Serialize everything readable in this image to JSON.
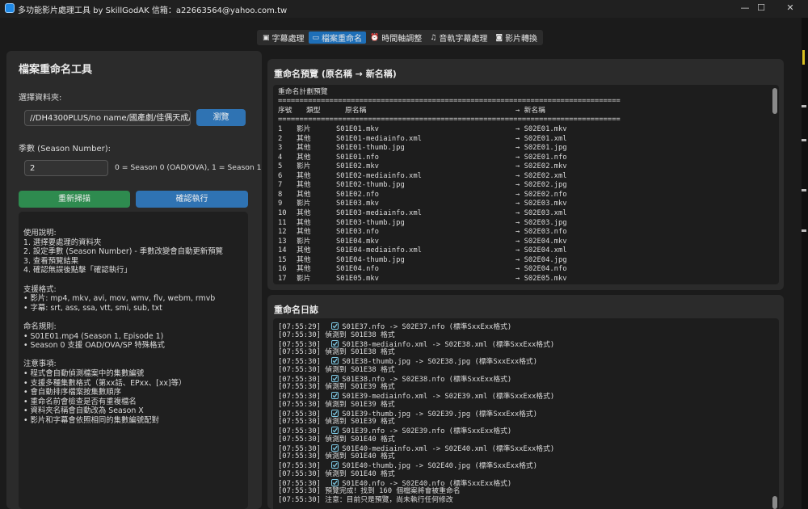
{
  "window": {
    "title": "多功能影片處理工具 by SkillGodAK 信箱：a22663564@yahoo.com.tw",
    "minimize_glyph": "—",
    "maximize_glyph": "☐",
    "close_glyph": "✕"
  },
  "tabs": [
    {
      "icon": "subtitle-icon",
      "glyph": "▣",
      "label": "字幕處理"
    },
    {
      "icon": "rename-icon",
      "glyph": "▭",
      "label": "檔案重命名"
    },
    {
      "icon": "timer-icon",
      "glyph": "⏰",
      "label": "時間軸調整"
    },
    {
      "icon": "music-icon",
      "glyph": "♫",
      "label": "音軌字幕處理"
    },
    {
      "icon": "convert-icon",
      "glyph": "◙",
      "label": "影片轉換"
    }
  ],
  "left": {
    "title": "檔案重命名工具",
    "folder_label": "選擇資料夾:",
    "folder_value": "//DH4300PLUS/no name/國產劇/佳偶天成/Se",
    "browse_label": "瀏覽",
    "season_label": "季數 (Season Number):",
    "season_value": "2",
    "season_hint": "0 = Season 0 (OAD/OVA), 1 = Season 1",
    "rescan_label": "重新掃描",
    "confirm_label": "確認執行",
    "instructions": [
      "使用說明:",
      "1. 選擇要處理的資料夾",
      "2. 設定季數 (Season Number) - 季數改變會自動更新預覽",
      "3. 查看預覽結果",
      "4. 確認無誤後點擊「確認執行」",
      "",
      "支援格式:",
      "• 影片: mp4, mkv, avi, mov, wmv, flv, webm, rmvb",
      "• 字幕: srt, ass, ssa, vtt, smi, sub, txt",
      "",
      "命名規則:",
      "• S01E01.mp4 (Season 1, Episode 1)",
      "• Season 0 支援 OAD/OVA/SP 特殊格式",
      "",
      "注意事項:",
      "• 程式會自動偵測檔案中的集數編號",
      "• 支援多種集數格式（第xx話、EPxx、[xx]等）",
      "• 會自動排序檔案按集數順序",
      "• 重命名前會檢查是否有重複檔名",
      "• 資料夾名稱會自動改為 Season X",
      "• 影片和字幕會依照相同的集數編號配對"
    ]
  },
  "preview": {
    "title": "重命名預覽 (原名稱 → 新名稱)",
    "plan_title": "重命名計劃預覽",
    "separator": "================================================================================",
    "headers": {
      "seq": "序號",
      "type": "類型",
      "orig": "原名稱",
      "new": "→ 新名稱"
    },
    "rows": [
      {
        "n": "1",
        "type": "影片",
        "orig": "S01E01.mkv",
        "new": "→ S02E01.mkv"
      },
      {
        "n": "2",
        "type": "其他",
        "orig": "S01E01-mediainfo.xml",
        "new": "→ S02E01.xml"
      },
      {
        "n": "3",
        "type": "其他",
        "orig": "S01E01-thumb.jpg",
        "new": "→ S02E01.jpg"
      },
      {
        "n": "4",
        "type": "其他",
        "orig": "S01E01.nfo",
        "new": "→ S02E01.nfo"
      },
      {
        "n": "5",
        "type": "影片",
        "orig": "S01E02.mkv",
        "new": "→ S02E02.mkv"
      },
      {
        "n": "6",
        "type": "其他",
        "orig": "S01E02-mediainfo.xml",
        "new": "→ S02E02.xml"
      },
      {
        "n": "7",
        "type": "其他",
        "orig": "S01E02-thumb.jpg",
        "new": "→ S02E02.jpg"
      },
      {
        "n": "8",
        "type": "其他",
        "orig": "S01E02.nfo",
        "new": "→ S02E02.nfo"
      },
      {
        "n": "9",
        "type": "影片",
        "orig": "S01E03.mkv",
        "new": "→ S02E03.mkv"
      },
      {
        "n": "10",
        "type": "其他",
        "orig": "S01E03-mediainfo.xml",
        "new": "→ S02E03.xml"
      },
      {
        "n": "11",
        "type": "其他",
        "orig": "S01E03-thumb.jpg",
        "new": "→ S02E03.jpg"
      },
      {
        "n": "12",
        "type": "其他",
        "orig": "S01E03.nfo",
        "new": "→ S02E03.nfo"
      },
      {
        "n": "13",
        "type": "影片",
        "orig": "S01E04.mkv",
        "new": "→ S02E04.mkv"
      },
      {
        "n": "14",
        "type": "其他",
        "orig": "S01E04-mediainfo.xml",
        "new": "→ S02E04.xml"
      },
      {
        "n": "15",
        "type": "其他",
        "orig": "S01E04-thumb.jpg",
        "new": "→ S02E04.jpg"
      },
      {
        "n": "16",
        "type": "其他",
        "orig": "S01E04.nfo",
        "new": "→ S02E04.nfo"
      },
      {
        "n": "17",
        "type": "影片",
        "orig": "S01E05.mkv",
        "new": "→ S02E05.mkv"
      }
    ]
  },
  "log": {
    "title": "重命名日誌",
    "lines": [
      {
        "t": "[07:55:29]",
        "check": true,
        "msg": "S01E37.nfo -> S02E37.nfo (標準SxxExx格式)"
      },
      {
        "t": "[07:55:30]",
        "check": false,
        "msg": "偵測到 S01E38 格式"
      },
      {
        "t": "[07:55:30]",
        "check": true,
        "msg": "S01E38-mediainfo.xml -> S02E38.xml (標準SxxExx格式)"
      },
      {
        "t": "[07:55:30]",
        "check": false,
        "msg": "偵測到 S01E38 格式"
      },
      {
        "t": "[07:55:30]",
        "check": true,
        "msg": "S01E38-thumb.jpg -> S02E38.jpg (標準SxxExx格式)"
      },
      {
        "t": "[07:55:30]",
        "check": false,
        "msg": "偵測到 S01E38 格式"
      },
      {
        "t": "[07:55:30]",
        "check": true,
        "msg": "S01E38.nfo -> S02E38.nfo (標準SxxExx格式)"
      },
      {
        "t": "[07:55:30]",
        "check": false,
        "msg": "偵測到 S01E39 格式"
      },
      {
        "t": "[07:55:30]",
        "check": true,
        "msg": "S01E39-mediainfo.xml -> S02E39.xml (標準SxxExx格式)"
      },
      {
        "t": "[07:55:30]",
        "check": false,
        "msg": "偵測到 S01E39 格式"
      },
      {
        "t": "[07:55:30]",
        "check": true,
        "msg": "S01E39-thumb.jpg -> S02E39.jpg (標準SxxExx格式)"
      },
      {
        "t": "[07:55:30]",
        "check": false,
        "msg": "偵測到 S01E39 格式"
      },
      {
        "t": "[07:55:30]",
        "check": true,
        "msg": "S01E39.nfo -> S02E39.nfo (標準SxxExx格式)"
      },
      {
        "t": "[07:55:30]",
        "check": false,
        "msg": "偵測到 S01E40 格式"
      },
      {
        "t": "[07:55:30]",
        "check": true,
        "msg": "S01E40-mediainfo.xml -> S02E40.xml (標準SxxExx格式)"
      },
      {
        "t": "[07:55:30]",
        "check": false,
        "msg": "偵測到 S01E40 格式"
      },
      {
        "t": "[07:55:30]",
        "check": true,
        "msg": "S01E40-thumb.jpg -> S02E40.jpg (標準SxxExx格式)"
      },
      {
        "t": "[07:55:30]",
        "check": false,
        "msg": "偵測到 S01E40 格式"
      },
      {
        "t": "[07:55:30]",
        "check": true,
        "msg": "S01E40.nfo -> S02E40.nfo (標準SxxExx格式)"
      },
      {
        "t": "[07:55:30]",
        "check": false,
        "msg": "預覽完成！找到 160 個檔案將會被重命名"
      },
      {
        "t": "[07:55:30]",
        "check": false,
        "msg": "注意：目前只是預覽，尚未執行任何修改"
      }
    ]
  },
  "colors": {
    "accent": "#1e6fb8",
    "rescan": "#2e8b4f",
    "confirm": "#2f73b3",
    "check": "#7ec8e3"
  }
}
